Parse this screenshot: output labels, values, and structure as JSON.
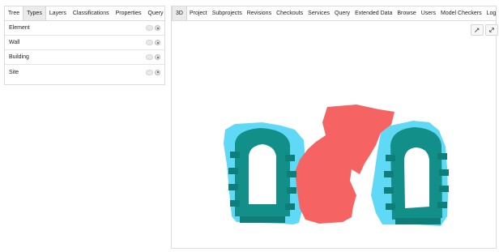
{
  "left_tabs": [
    "Tree",
    "Types",
    "Layers",
    "Classifications",
    "Properties",
    "Query"
  ],
  "left_active_tab": "Types",
  "types": [
    {
      "label": "Element"
    },
    {
      "label": "Wall"
    },
    {
      "label": "Building"
    },
    {
      "label": "Site"
    }
  ],
  "right_tabs": [
    "3D",
    "Project",
    "Subprojects",
    "Revisions",
    "Checkouts",
    "Services",
    "Query",
    "Extended Data",
    "Browse",
    "Users",
    "Model Checkers",
    "Log"
  ],
  "right_active_tab": "3D",
  "toolbar": {
    "settings_icon": "wrench-icon",
    "fullscreen_icon": "expand-icon"
  },
  "colors": {
    "teal": "#138f8a",
    "cyan": "#5fd9f5",
    "coral": "#f56363",
    "tab_active": "#ebebeb"
  }
}
